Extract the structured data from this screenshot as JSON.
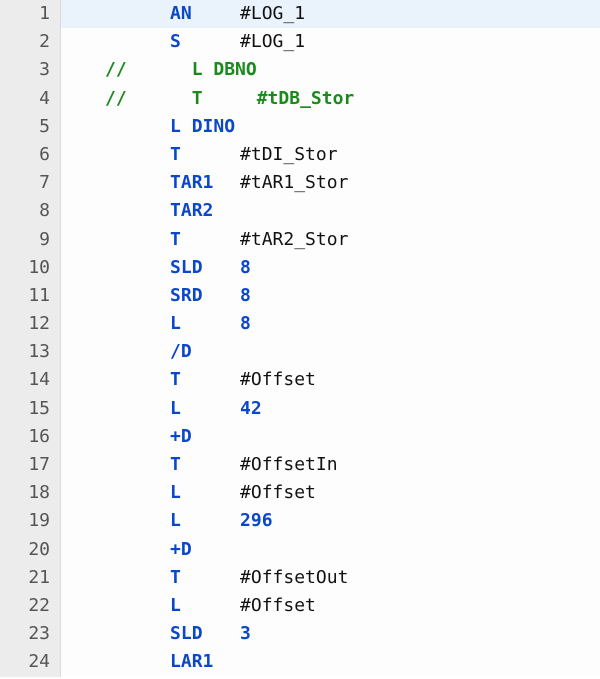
{
  "lines": [
    {
      "n": "1",
      "type": "stl",
      "indent": "      ",
      "instr": "AN",
      "op": "#LOG_1",
      "opKind": "op",
      "highlight": true
    },
    {
      "n": "2",
      "type": "stl",
      "indent": "      ",
      "instr": "S",
      "op": "#LOG_1",
      "opKind": "op"
    },
    {
      "n": "3",
      "type": "comment",
      "text": "//      L DBNO"
    },
    {
      "n": "4",
      "type": "comment",
      "text": "//      T     #tDB_Stor"
    },
    {
      "n": "5",
      "type": "raw-instr",
      "indent": "      ",
      "instr": "L DINO"
    },
    {
      "n": "6",
      "type": "stl",
      "indent": "      ",
      "instr": "T",
      "op": "#tDI_Stor",
      "opKind": "op"
    },
    {
      "n": "7",
      "type": "stl",
      "indent": "      ",
      "instr": "TAR1",
      "op": "#tAR1_Stor",
      "opKind": "op"
    },
    {
      "n": "8",
      "type": "stl",
      "indent": "      ",
      "instr": "TAR2",
      "op": "",
      "opKind": "op"
    },
    {
      "n": "9",
      "type": "stl",
      "indent": "      ",
      "instr": "T",
      "op": "#tAR2_Stor",
      "opKind": "op"
    },
    {
      "n": "10",
      "type": "stl",
      "indent": "      ",
      "instr": "SLD",
      "op": "8",
      "opKind": "num"
    },
    {
      "n": "11",
      "type": "stl",
      "indent": "      ",
      "instr": "SRD",
      "op": "8",
      "opKind": "num"
    },
    {
      "n": "12",
      "type": "stl",
      "indent": "      ",
      "instr": "L",
      "op": "8",
      "opKind": "num"
    },
    {
      "n": "13",
      "type": "stl",
      "indent": "      ",
      "instr": "/D",
      "op": "",
      "opKind": "op"
    },
    {
      "n": "14",
      "type": "stl",
      "indent": "      ",
      "instr": "T",
      "op": "#Offset",
      "opKind": "op"
    },
    {
      "n": "15",
      "type": "stl",
      "indent": "      ",
      "instr": "L",
      "op": "42",
      "opKind": "num"
    },
    {
      "n": "16",
      "type": "stl",
      "indent": "      ",
      "instr": "+D",
      "op": "",
      "opKind": "op"
    },
    {
      "n": "17",
      "type": "stl",
      "indent": "      ",
      "instr": "T",
      "op": "#OffsetIn",
      "opKind": "op"
    },
    {
      "n": "18",
      "type": "stl",
      "indent": "      ",
      "instr": "L",
      "op": "#Offset",
      "opKind": "op"
    },
    {
      "n": "19",
      "type": "stl",
      "indent": "      ",
      "instr": "L",
      "op": "296",
      "opKind": "num"
    },
    {
      "n": "20",
      "type": "stl",
      "indent": "      ",
      "instr": "+D",
      "op": "",
      "opKind": "op"
    },
    {
      "n": "21",
      "type": "stl",
      "indent": "      ",
      "instr": "T",
      "op": "#OffsetOut",
      "opKind": "op"
    },
    {
      "n": "22",
      "type": "stl",
      "indent": "      ",
      "instr": "L",
      "op": "#Offset",
      "opKind": "op"
    },
    {
      "n": "23",
      "type": "stl",
      "indent": "      ",
      "instr": "SLD",
      "op": "3",
      "opKind": "num"
    },
    {
      "n": "24",
      "type": "stl",
      "indent": "      ",
      "instr": "LAR1",
      "op": "",
      "opKind": "op"
    }
  ]
}
